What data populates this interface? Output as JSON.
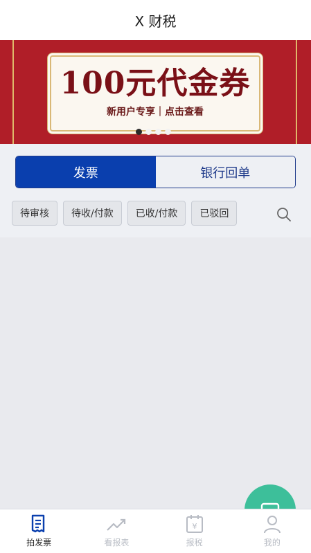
{
  "header": {
    "title": "X 财税"
  },
  "banner": {
    "title": "100元代金券",
    "subtitle": "新用户专享｜点击查看",
    "background": "#b01e28",
    "dots_total": 4,
    "dots_active_index": 0
  },
  "segment": {
    "tabs": [
      {
        "label": "发票",
        "active": true
      },
      {
        "label": "银行回单",
        "active": false
      }
    ],
    "active_color": "#0a3fae"
  },
  "filters": {
    "chips": [
      "待审核",
      "待收/付款",
      "已收/付款",
      "已驳回"
    ],
    "search_icon": "search-icon"
  },
  "fab": {
    "icon": "image-icon",
    "color": "#3dbf9a"
  },
  "tabbar": {
    "items": [
      {
        "label": "拍发票",
        "icon": "invoice-icon",
        "active": true
      },
      {
        "label": "看报表",
        "icon": "trend-icon",
        "active": false
      },
      {
        "label": "报税",
        "icon": "calendar-tax-icon",
        "active": false
      },
      {
        "label": "我的",
        "icon": "user-icon",
        "active": false
      }
    ]
  }
}
